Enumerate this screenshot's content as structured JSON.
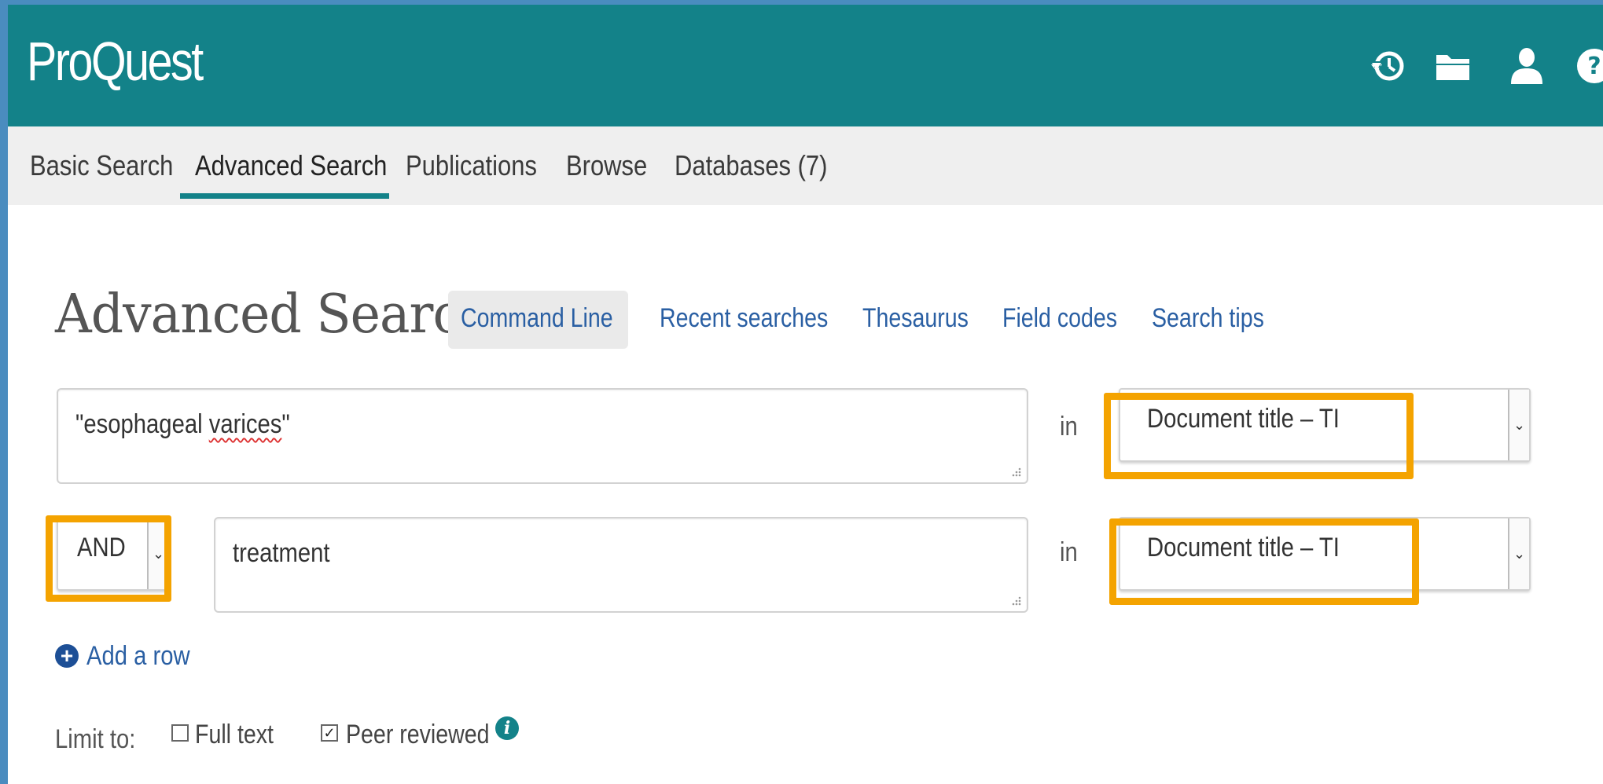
{
  "header": {
    "logo": "ProQuest",
    "icons": [
      "history-icon",
      "folder-icon",
      "user-icon",
      "help-icon"
    ]
  },
  "nav": {
    "tabs": [
      "Basic Search",
      "Advanced Search",
      "Publications",
      "Browse",
      "Databases (7)"
    ],
    "active_tab": "Advanced Search"
  },
  "page": {
    "title": "Advanced Search",
    "links": [
      "Command Line",
      "Recent searches",
      "Thesaurus",
      "Field codes",
      "Search tips"
    ]
  },
  "rows": [
    {
      "term_before": "\"esophageal ",
      "term_misspelled": "varices",
      "term_after": "\"",
      "in_label": "in",
      "field": "Document title – TI"
    },
    {
      "operator": "AND",
      "term": "treatment",
      "in_label": "in",
      "field": "Document title – TI"
    }
  ],
  "add_row": {
    "label": "Add a row"
  },
  "limit": {
    "label": "Limit to:",
    "options": [
      {
        "label": "Full text",
        "checked": false
      },
      {
        "label": "Peer reviewed",
        "checked": true
      }
    ]
  },
  "colors": {
    "brand": "#138289",
    "highlight": "#f4a300",
    "link": "#2a5fa3"
  }
}
